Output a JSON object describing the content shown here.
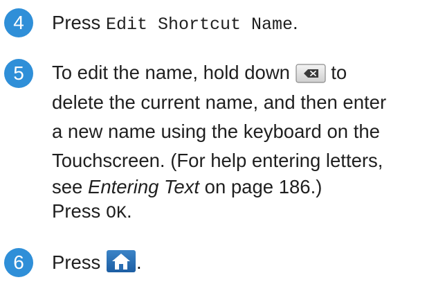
{
  "step4": {
    "number": "4",
    "prefix": "Press",
    "button_label": "Edit Shortcut Name",
    "suffix": "."
  },
  "step5": {
    "number": "5",
    "line1_before": "To edit the name, hold down",
    "backspace_icon": "backspace-key-icon",
    "line1_after": "to",
    "line2": "delete the current name, and then enter",
    "line3": "a new name using the keyboard on the",
    "line4": "Touchscreen. (For help entering letters,",
    "line5_before": "see",
    "line5_link": "Entering Text",
    "line5_after": "on page 186.)",
    "line6_prefix": "Press",
    "line6_button": "OK",
    "line6_suffix": "."
  },
  "step6": {
    "number": "6",
    "prefix": "Press",
    "home_icon": "home-button-icon",
    "suffix": "."
  },
  "colors": {
    "badge": "#2f8fd8",
    "text": "#1f1f1f"
  }
}
